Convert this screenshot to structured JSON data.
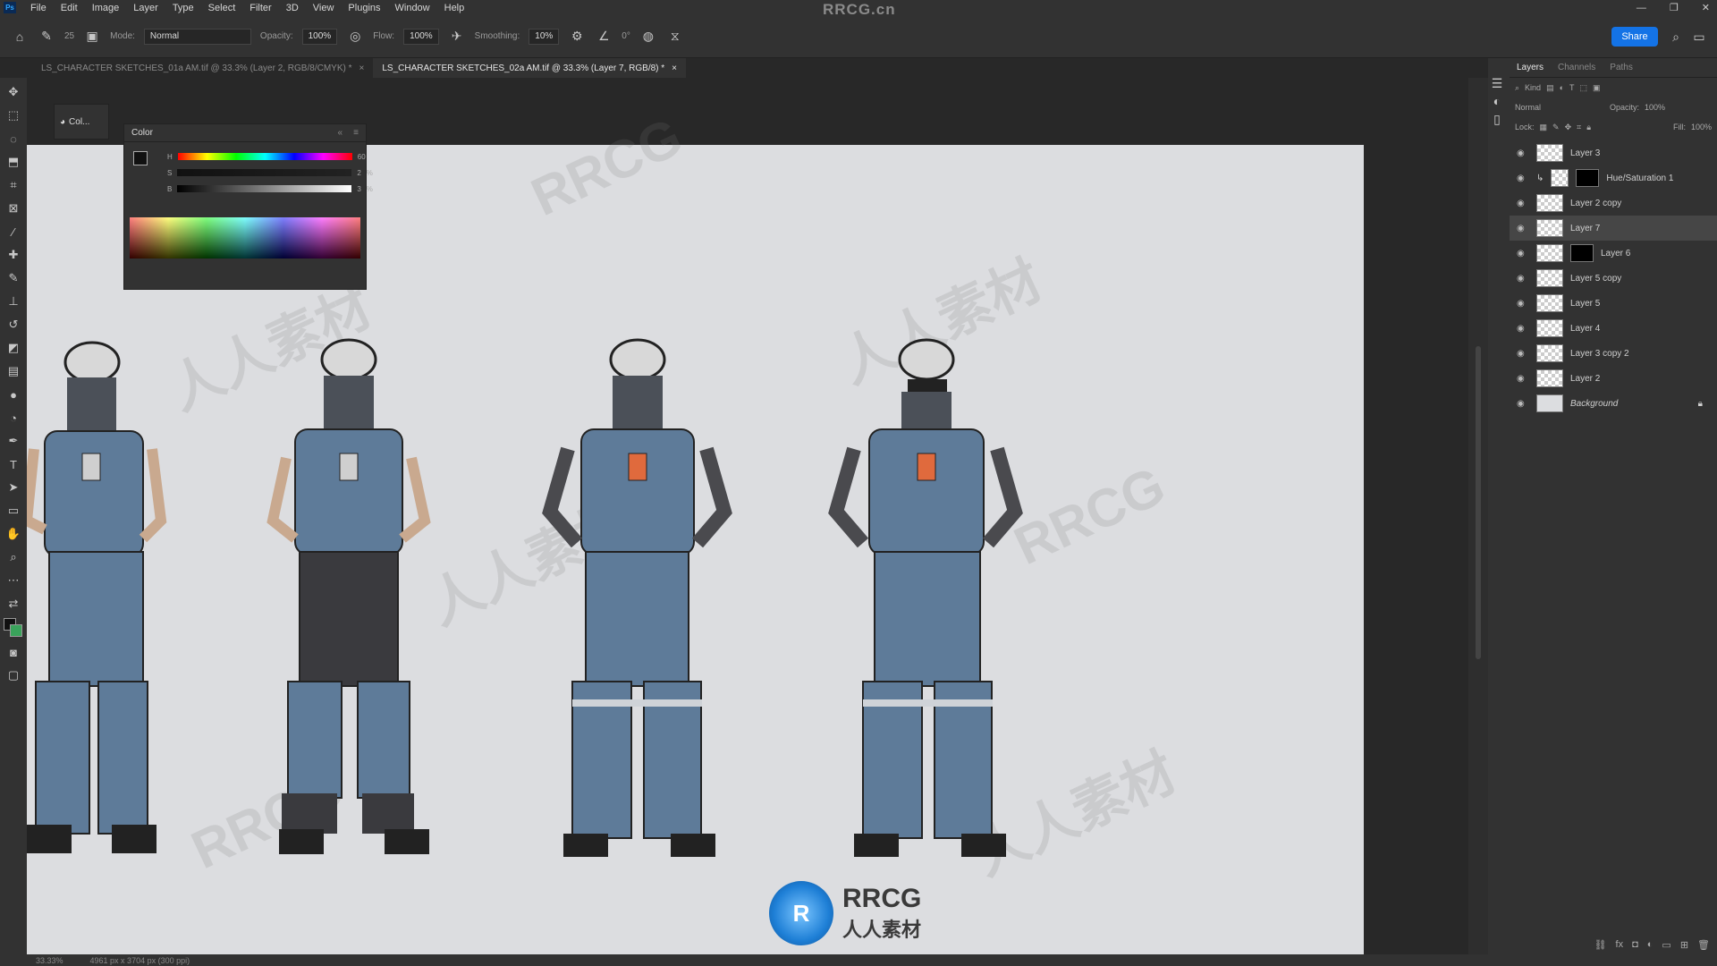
{
  "menubar": {
    "app_icon": "Ps",
    "items": [
      "File",
      "Edit",
      "Image",
      "Layer",
      "Type",
      "Select",
      "Filter",
      "3D",
      "View",
      "Plugins",
      "Window",
      "Help"
    ],
    "center_watermark": "RRCG.cn"
  },
  "options": {
    "mode_label": "Mode:",
    "mode_value": "Normal",
    "opacity_label": "Opacity:",
    "opacity_value": "100%",
    "flow_label": "Flow:",
    "flow_value": "100%",
    "smoothing_label": "Smoothing:",
    "smoothing_value": "10%",
    "angle_value": "0°",
    "brush_size": "25",
    "share_label": "Share"
  },
  "tabs": [
    {
      "label": "LS_CHARACTER SKETCHES_01a AM.tif @ 33.3% (Layer 2, RGB/8/CMYK) *"
    },
    {
      "label": "LS_CHARACTER SKETCHES_02a AM.tif @ 33.3% (Layer 7, RGB/8) *"
    }
  ],
  "color_panel": {
    "title": "Color",
    "mini_label": "Col...",
    "h_label": "H",
    "h_value": "60",
    "s_label": "S",
    "s_value": "2",
    "b_label": "B",
    "b_value": "3",
    "unit": "%"
  },
  "layers_panel": {
    "tabs": [
      "Layers",
      "Channels",
      "Paths"
    ],
    "filter_label": "Kind",
    "blend": "Normal",
    "opacity_label": "Opacity:",
    "opacity_value": "100%",
    "lock_label": "Lock:",
    "fill_label": "Fill:",
    "fill_value": "100%",
    "layers": [
      {
        "name": "Layer 3"
      },
      {
        "name": "Hue/Saturation 1"
      },
      {
        "name": "Layer 2 copy"
      },
      {
        "name": "Layer 7"
      },
      {
        "name": "Layer 6"
      },
      {
        "name": "Layer 5 copy"
      },
      {
        "name": "Layer 5"
      },
      {
        "name": "Layer 4"
      },
      {
        "name": "Layer 3 copy 2"
      },
      {
        "name": "Layer 2"
      },
      {
        "name": "Background"
      }
    ]
  },
  "status": {
    "zoom": "33.33%",
    "doc_info": "4961 px x 3704 px (300 ppi)"
  },
  "watermarks": {
    "rrcg": "RRCG",
    "cn": "人人素材",
    "logo_top": "RRCG",
    "logo_bottom": "人人素材"
  }
}
